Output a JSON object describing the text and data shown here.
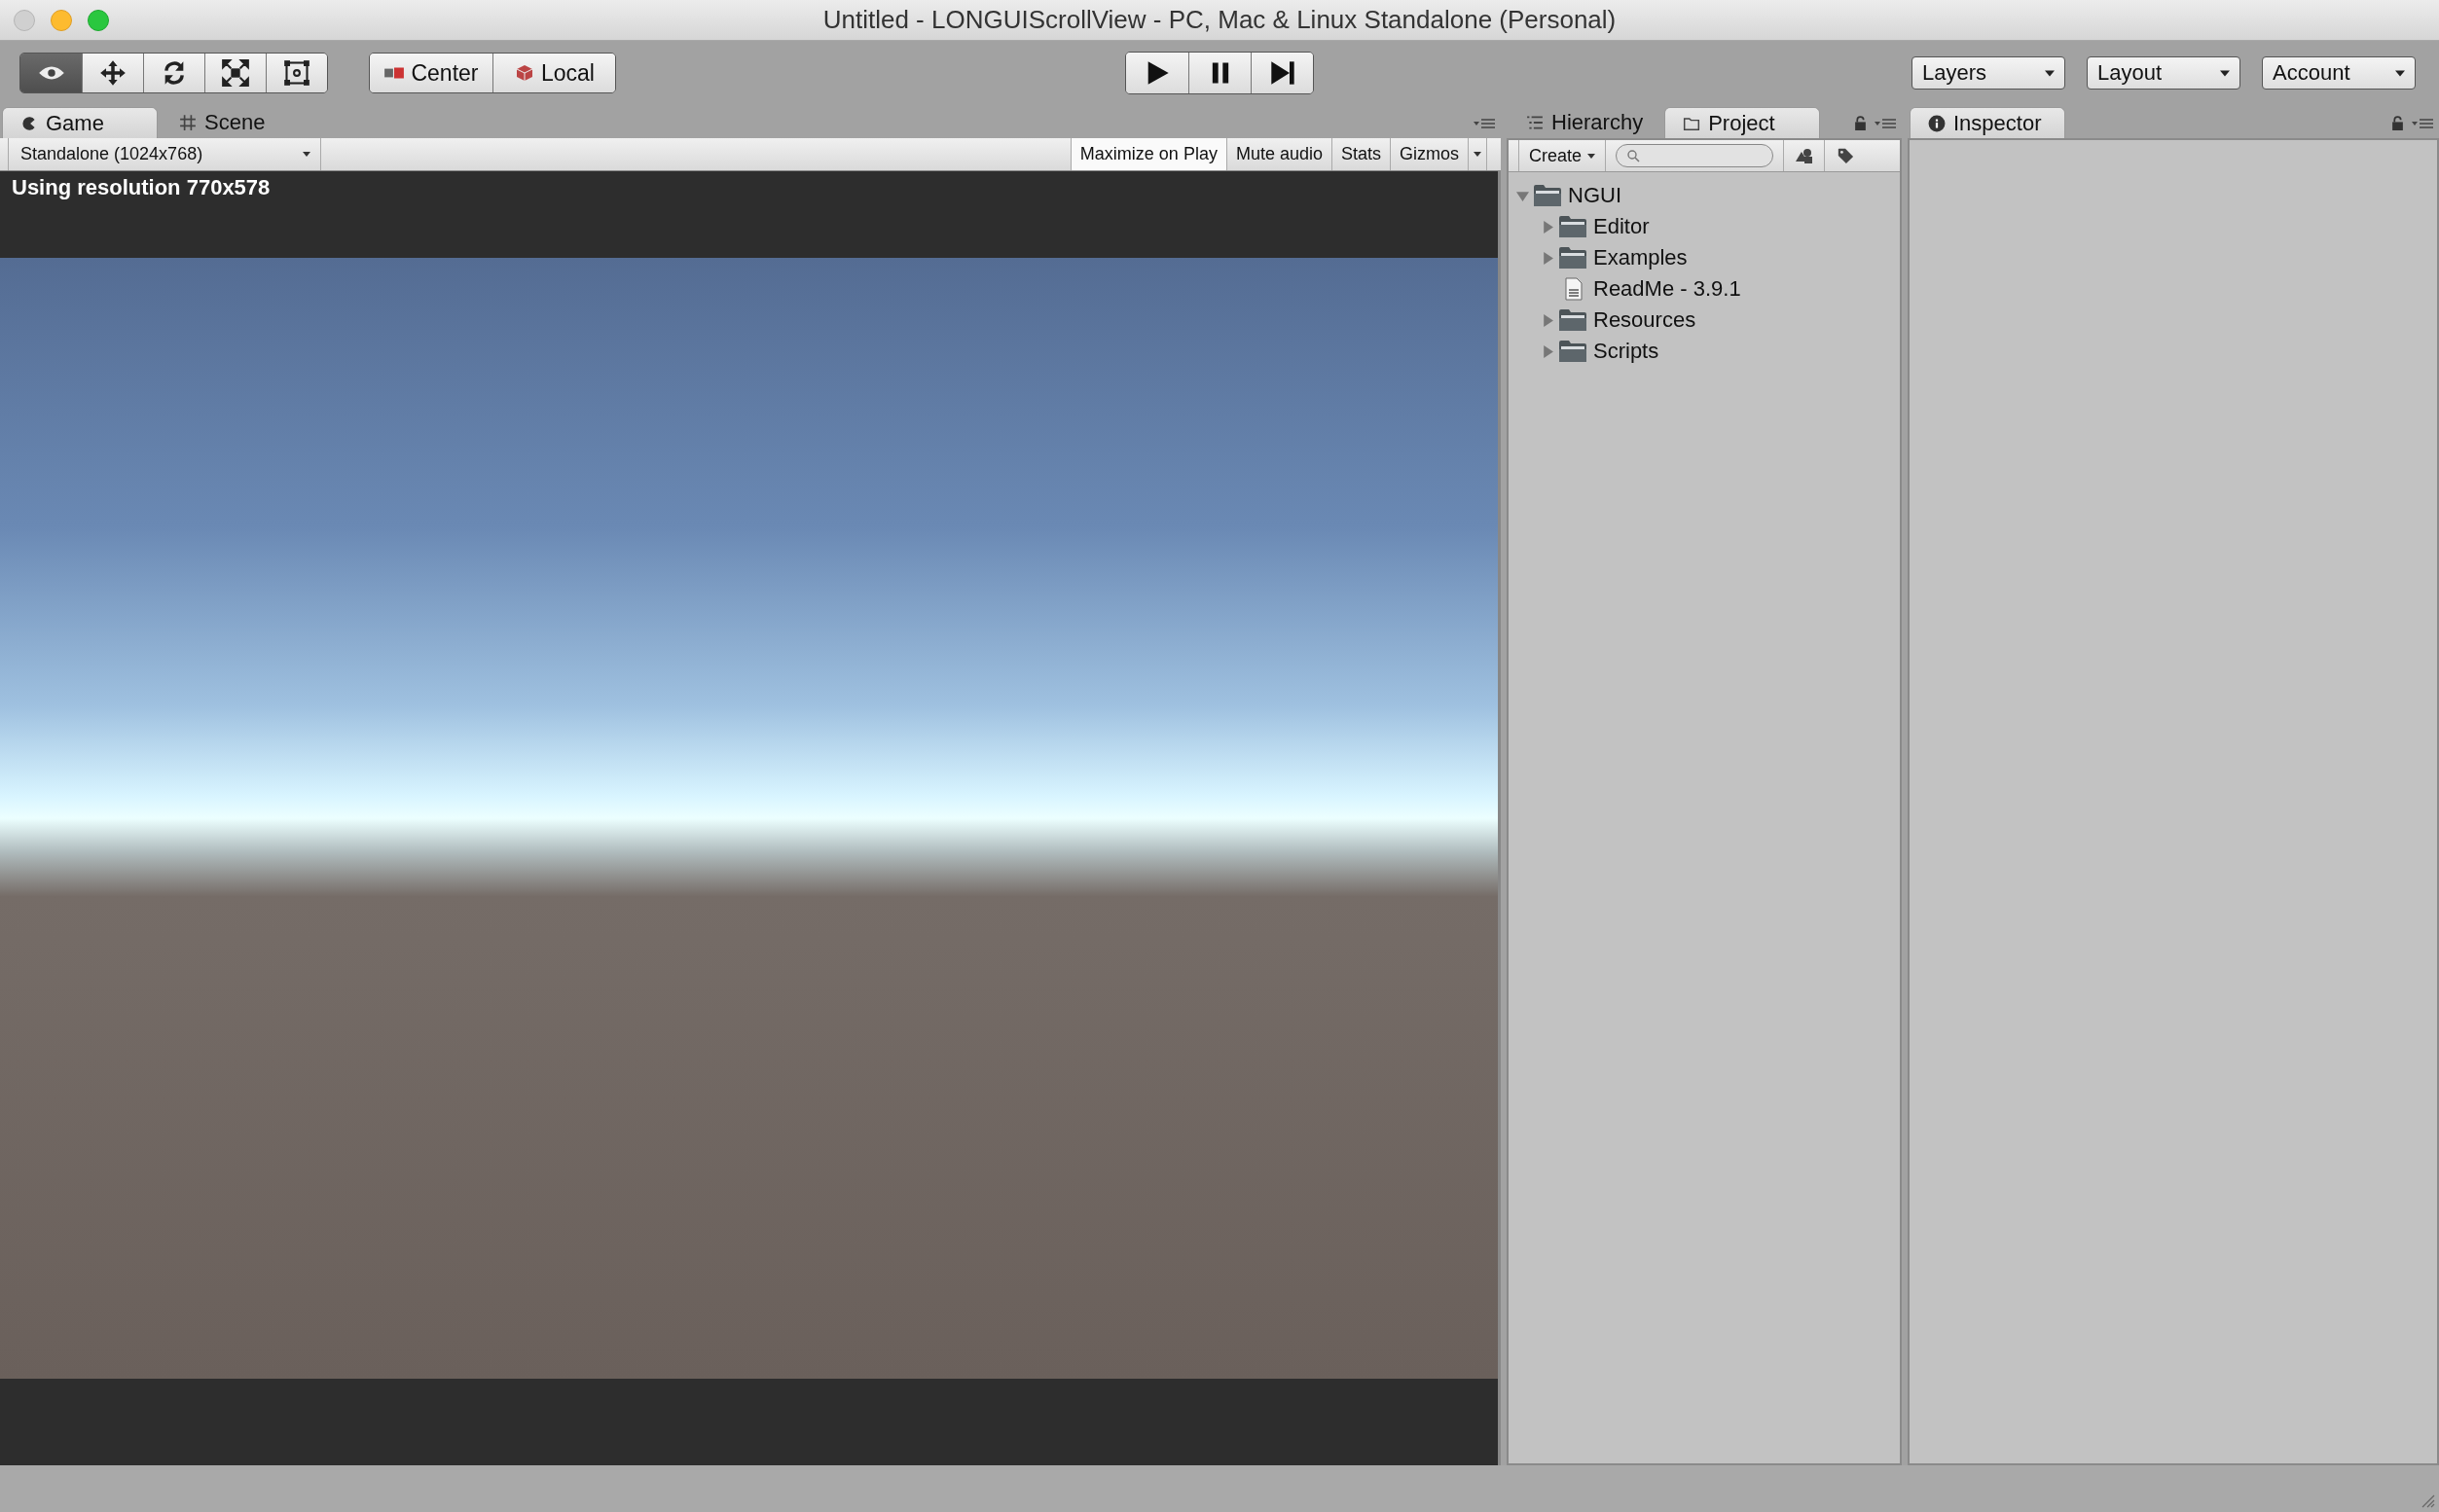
{
  "window": {
    "title": "Untitled - LONGUIScrollView - PC, Mac & Linux Standalone (Personal)"
  },
  "toolbar": {
    "tools": [
      {
        "kind": "view",
        "selected": true
      },
      {
        "kind": "move",
        "selected": false
      },
      {
        "kind": "rotate",
        "selected": false
      },
      {
        "kind": "scale",
        "selected": false
      },
      {
        "kind": "rect",
        "selected": false
      }
    ],
    "pivot": [
      {
        "kind": "center",
        "label": "Center"
      },
      {
        "kind": "local",
        "label": "Local"
      }
    ],
    "dropdowns": [
      "Layers",
      "Layout",
      "Account"
    ]
  },
  "game_panel": {
    "tabs": [
      {
        "kind": "game",
        "label": "Game",
        "selected": true
      },
      {
        "kind": "scene",
        "label": "Scene",
        "selected": false
      }
    ],
    "resolution": "Standalone (1024x768)",
    "toggles": [
      {
        "label": "Maximize on Play",
        "on": true
      },
      {
        "label": "Mute audio",
        "on": false
      },
      {
        "label": "Stats",
        "on": false
      }
    ],
    "gizmos": "Gizmos",
    "overlay": "Using resolution 770x578"
  },
  "project_panel": {
    "tabs": [
      {
        "kind": "hierarchy",
        "label": "Hierarchy",
        "selected": false
      },
      {
        "kind": "project",
        "label": "Project",
        "selected": true
      }
    ],
    "create": "Create",
    "tree": [
      {
        "kind": "folder",
        "label": "NGUI",
        "expanded": true,
        "children": [
          {
            "kind": "folder",
            "label": "Editor",
            "expanded": false
          },
          {
            "kind": "folder",
            "label": "Examples",
            "expanded": false
          },
          {
            "kind": "file",
            "label": "ReadMe - 3.9.1"
          },
          {
            "kind": "folder",
            "label": "Resources",
            "expanded": false
          },
          {
            "kind": "folder",
            "label": "Scripts",
            "expanded": false
          }
        ]
      }
    ]
  },
  "inspector_panel": {
    "tab": "Inspector"
  }
}
